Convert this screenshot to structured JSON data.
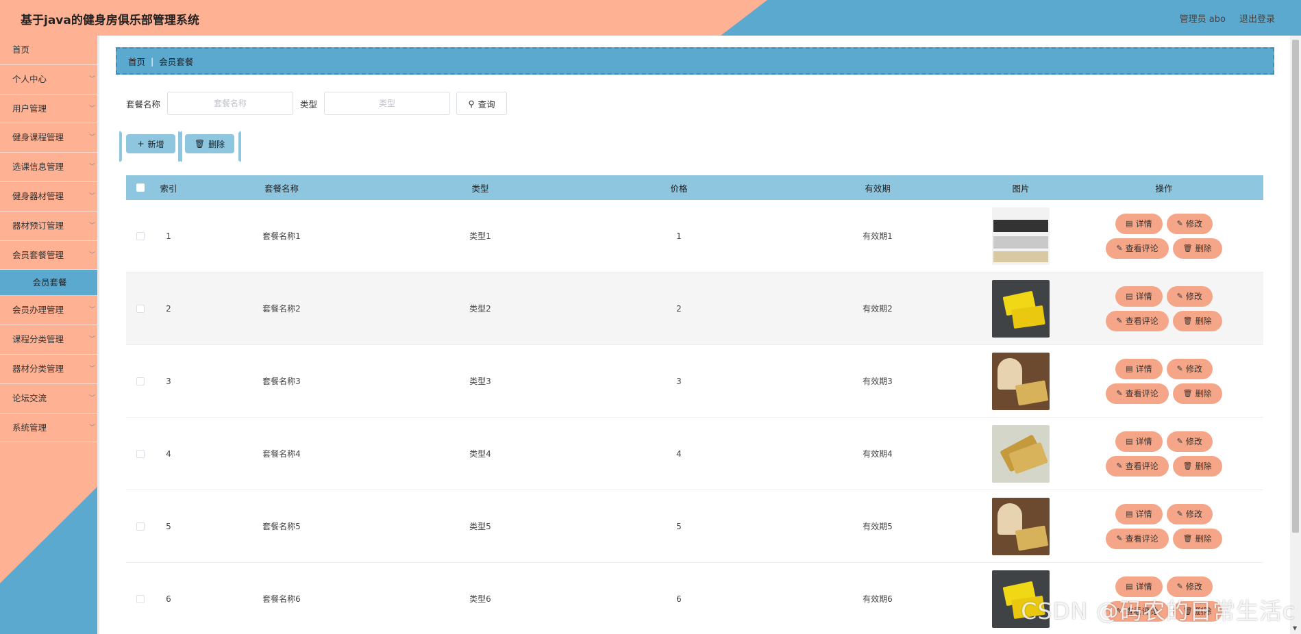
{
  "app": {
    "title": "基于java的健身房俱乐部管理系统",
    "user_label": "管理员 abo",
    "logout_label": "退出登录"
  },
  "sidebar": {
    "items": [
      {
        "label": "首页",
        "chevron": false
      },
      {
        "label": "个人中心",
        "chevron": true
      },
      {
        "label": "用户管理",
        "chevron": true
      },
      {
        "label": "健身课程管理",
        "chevron": true
      },
      {
        "label": "选课信息管理",
        "chevron": true
      },
      {
        "label": "健身器材管理",
        "chevron": true
      },
      {
        "label": "器材预订管理",
        "chevron": true
      },
      {
        "label": "会员套餐管理",
        "chevron": true
      },
      {
        "label": "会员套餐",
        "sub": true
      },
      {
        "label": "会员办理管理",
        "chevron": true
      },
      {
        "label": "课程分类管理",
        "chevron": true
      },
      {
        "label": "器材分类管理",
        "chevron": true
      },
      {
        "label": "论坛交流",
        "chevron": true
      },
      {
        "label": "系统管理",
        "chevron": true
      }
    ]
  },
  "breadcrumb": {
    "home": "首页",
    "current": "会员套餐"
  },
  "search": {
    "name_label": "套餐名称",
    "name_placeholder": "套餐名称",
    "type_label": "类型",
    "type_placeholder": "类型",
    "query_label": "查询"
  },
  "actions": {
    "add_label": "新增",
    "delete_label": "删除"
  },
  "table": {
    "headers": {
      "index": "索引",
      "name": "套餐名称",
      "type": "类型",
      "price": "价格",
      "validity": "有效期",
      "image": "图片",
      "ops": "操作"
    },
    "rows": [
      {
        "index": "1",
        "name": "套餐名称1",
        "type": "类型1",
        "price": "1",
        "validity": "有效期1",
        "image": "membership-card-photo"
      },
      {
        "index": "2",
        "name": "套餐名称2",
        "type": "类型2",
        "price": "2",
        "validity": "有效期2",
        "image": "membership-card-photo"
      },
      {
        "index": "3",
        "name": "套餐名称3",
        "type": "类型3",
        "price": "3",
        "validity": "有效期3",
        "image": "membership-card-photo"
      },
      {
        "index": "4",
        "name": "套餐名称4",
        "type": "类型4",
        "price": "4",
        "validity": "有效期4",
        "image": "membership-card-photo"
      },
      {
        "index": "5",
        "name": "套餐名称5",
        "type": "类型5",
        "price": "5",
        "validity": "有效期5",
        "image": "membership-card-photo"
      },
      {
        "index": "6",
        "name": "套餐名称6",
        "type": "类型6",
        "price": "6",
        "validity": "有效期6",
        "image": "membership-card-photo"
      }
    ],
    "op_labels": {
      "detail": "详情",
      "edit": "修改",
      "comments": "查看评论",
      "delete": "删除"
    }
  },
  "watermark": "CSDN @码农的日常生活c",
  "colors": {
    "salmon": "#ffb194",
    "blue": "#5ca9d0",
    "table_header": "#8ec5df",
    "op_button": "#f5a688"
  }
}
